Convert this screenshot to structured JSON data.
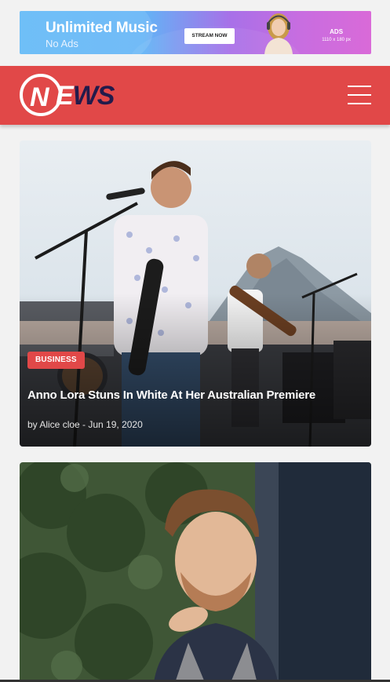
{
  "ad": {
    "title": "Unlimited Music",
    "subtitle": "No Ads",
    "cta_label": "STREAM NOW",
    "label": "ADS",
    "size_text": "1110 x 180 px"
  },
  "header": {
    "logo_n": "N",
    "logo_e": "E",
    "logo_ws": "WS",
    "brand_color": "#e14848",
    "menu_icon": "hamburger-menu-icon"
  },
  "articles": [
    {
      "category": "BUSINESS",
      "title": "Anno Lora Stuns In White At Her Australian Premiere",
      "meta": "by Alice cloe - Jun 19, 2020",
      "image": "concert-violinist-photo"
    },
    {
      "image": "man-portrait-photo"
    }
  ]
}
